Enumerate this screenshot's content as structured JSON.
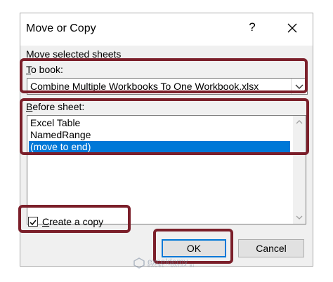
{
  "dialog": {
    "title": "Move or Copy",
    "help_label": "?",
    "section_label": "Move selected sheets",
    "to_book": {
      "label_mnemonic": "T",
      "label_rest": "o book:",
      "value": "Combine Multiple Workbooks To One Workbook.xlsx"
    },
    "before_sheet": {
      "label_mnemonic": "B",
      "label_rest": "efore sheet:",
      "items": [
        "Excel Table",
        "NamedRange",
        "(move to end)"
      ],
      "selected_index": 2
    },
    "create_copy": {
      "label_mnemonic": "C",
      "label_rest": "reate a copy",
      "checked": true
    },
    "buttons": {
      "ok": "OK",
      "cancel": "Cancel"
    }
  },
  "watermark": {
    "name": "exceldemy",
    "tagline": "EXCEL · DATA · BI"
  },
  "colors": {
    "highlight": "#7b1f2a",
    "selection": "#0078d7"
  }
}
